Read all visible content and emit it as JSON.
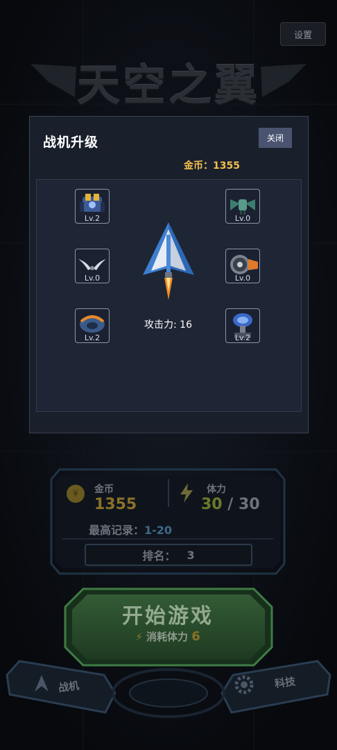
{
  "settings_label": "设置",
  "game_title": "天空之翼",
  "stats": {
    "coin_label": "金币",
    "coin_value": "1355",
    "stamina_label": "体力",
    "stamina_current": "30",
    "stamina_sep": "/",
    "stamina_max": "30",
    "record_label": "最高记录：",
    "record_value": "1-20",
    "rank_label": "排名：",
    "rank_value": "3"
  },
  "start": {
    "label": "开始游戏",
    "cost_label": "消耗体力",
    "cost_value": "6"
  },
  "nav": {
    "fighter": "战机",
    "tech": "科技"
  },
  "modal": {
    "title": "战机升级",
    "close_label": "关闭",
    "gold_text": "金币：1355",
    "attack_text": "攻击力: 16",
    "slots": [
      {
        "level": "Lv.2",
        "icon": "blue-mech-icon"
      },
      {
        "level": "Lv.0",
        "icon": "green-drone-icon"
      },
      {
        "level": "Lv.0",
        "icon": "silver-wings-icon"
      },
      {
        "level": "Lv.0",
        "icon": "jet-engine-icon"
      },
      {
        "level": "Lv.2",
        "icon": "armored-craft-icon"
      },
      {
        "level": "Lv.2",
        "icon": "radar-dish-icon"
      }
    ]
  },
  "colors": {
    "accent_gold": "#f2c14e",
    "panel_bg": "#1a1f2c",
    "close_button": "#4a5470",
    "start_button": "#2f5a33"
  }
}
